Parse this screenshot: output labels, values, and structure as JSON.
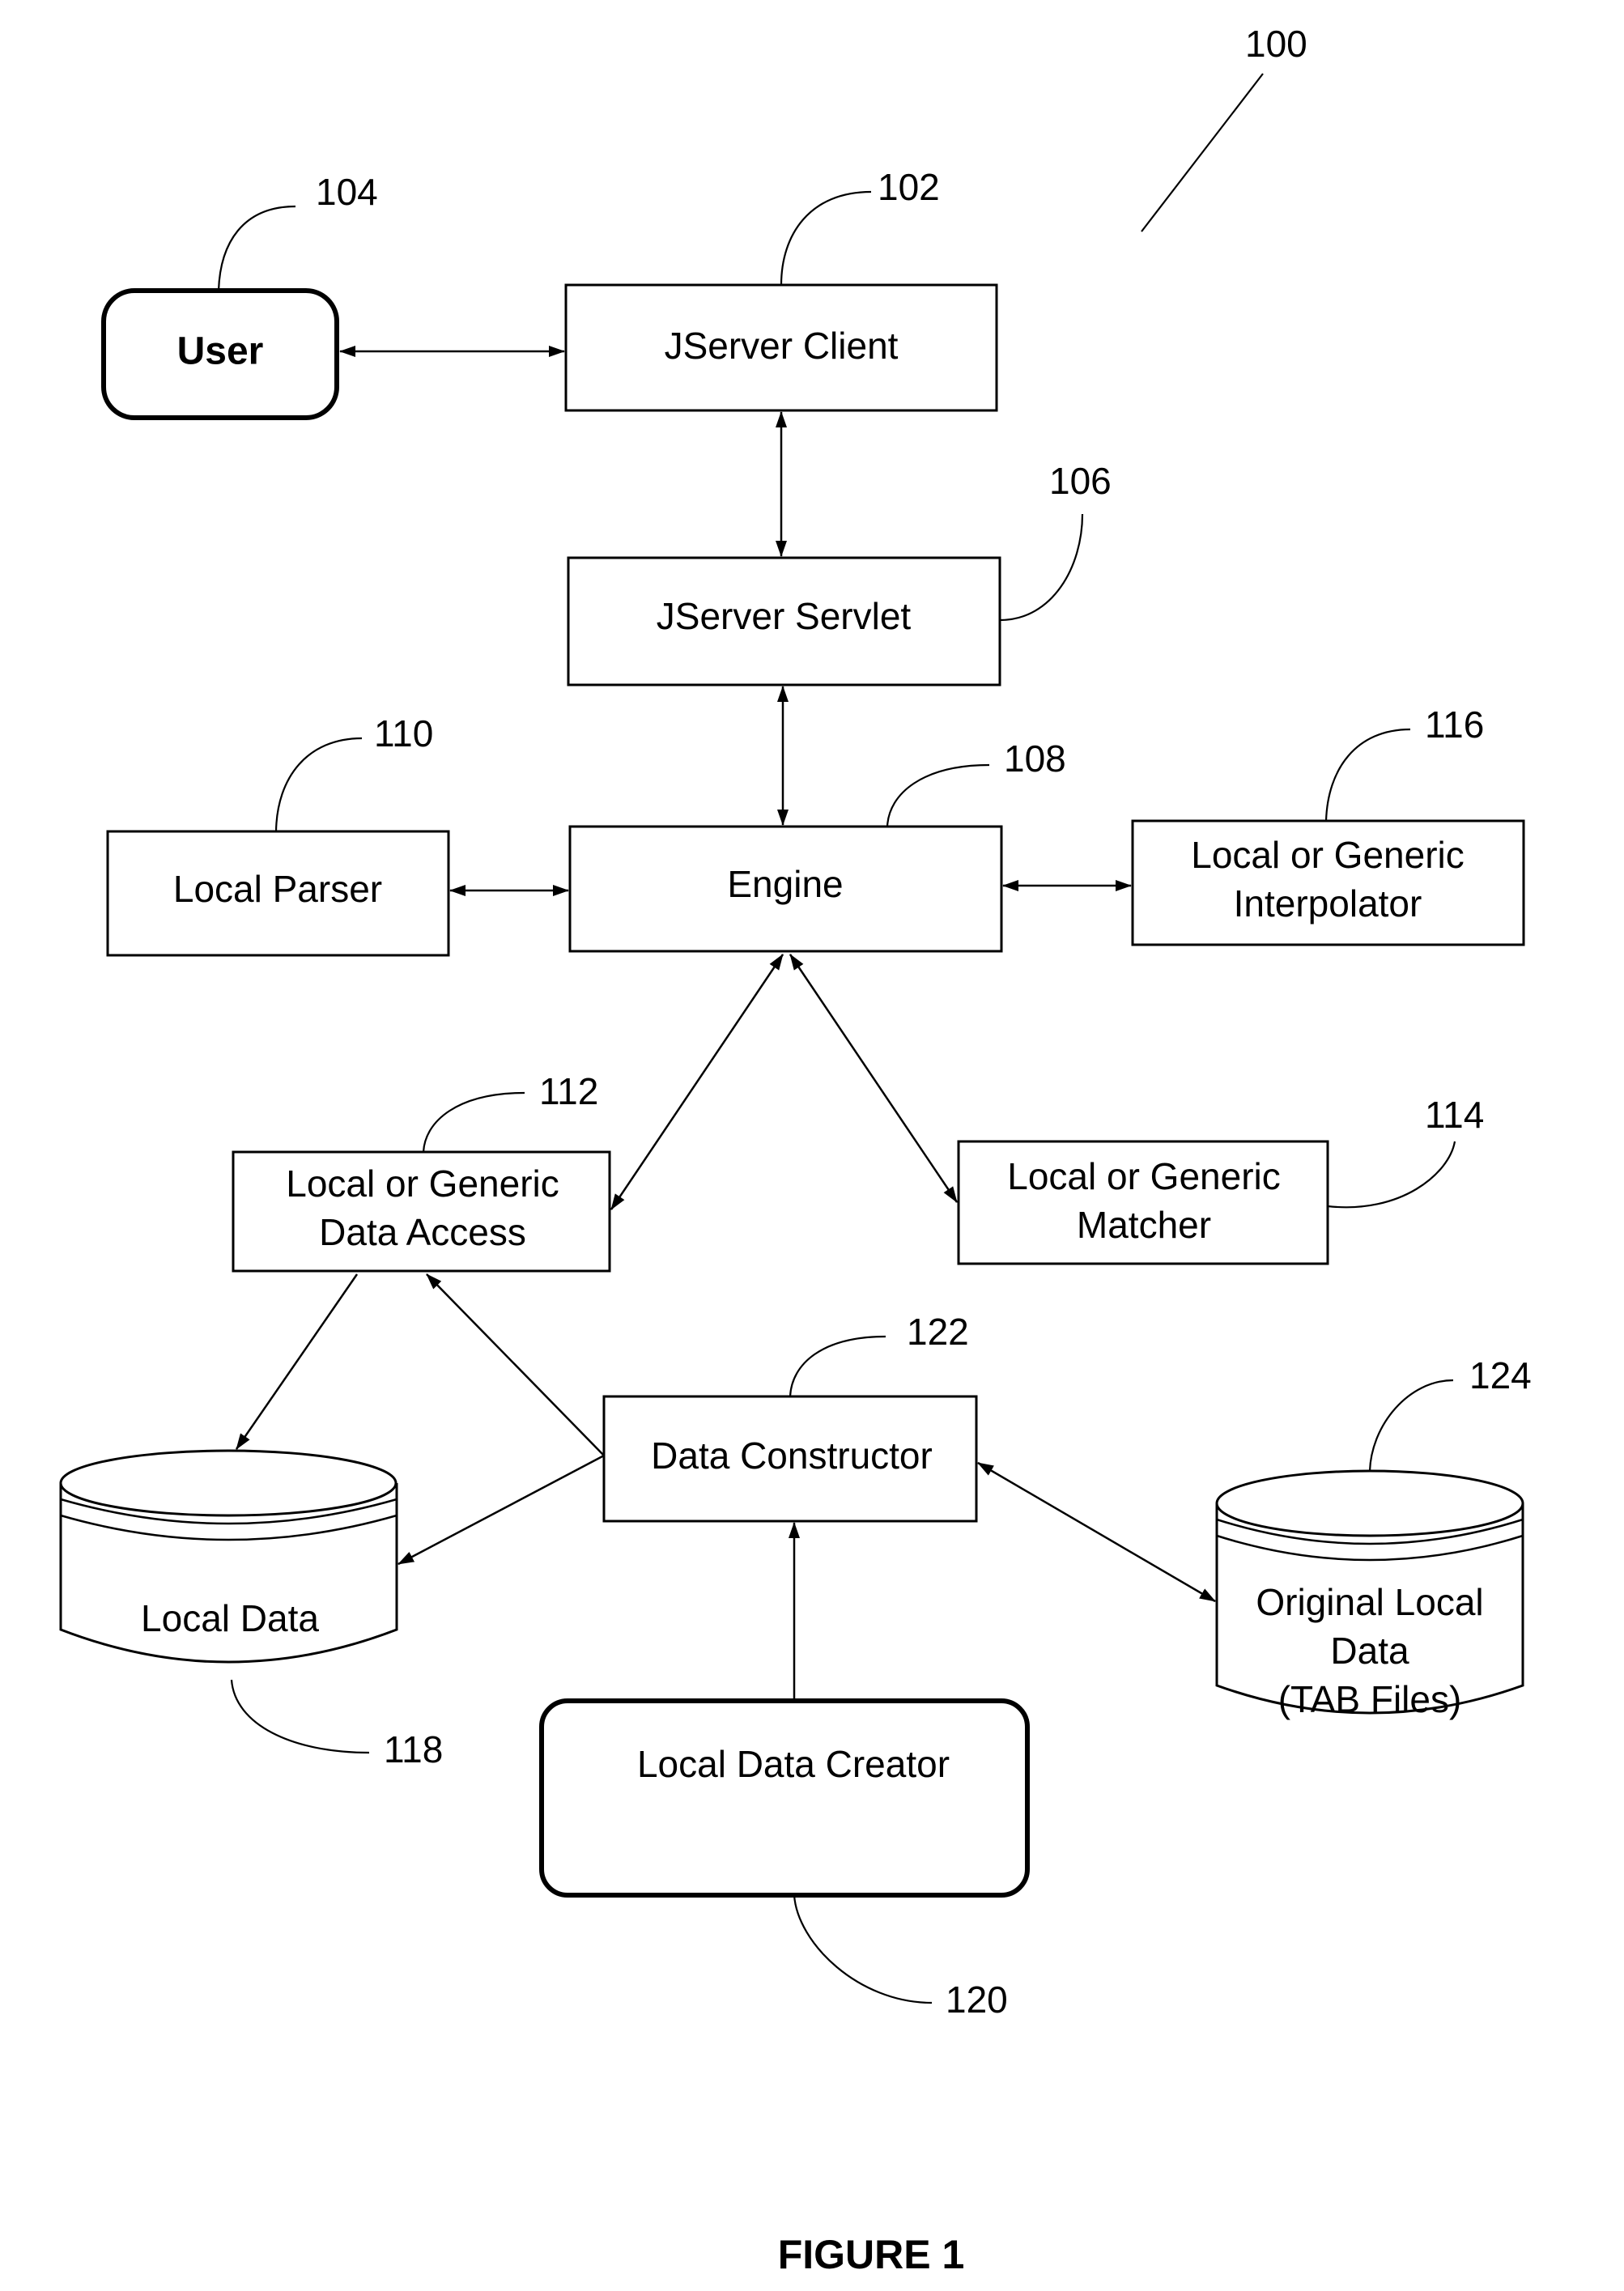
{
  "figure": {
    "caption": "FIGURE 1",
    "system_ref": "100"
  },
  "nodes": {
    "user": {
      "label": "User",
      "ref": "104"
    },
    "jserver_client": {
      "label": "JServer Client",
      "ref": "102"
    },
    "jserver_servlet": {
      "label": "JServer Servlet",
      "ref": "106"
    },
    "engine": {
      "label": "Engine",
      "ref": "108"
    },
    "local_parser": {
      "label": "Local Parser",
      "ref": "110"
    },
    "interpolator": {
      "label_lines": [
        "Local or Generic",
        "Interpolator"
      ],
      "ref": "116"
    },
    "data_access": {
      "label_lines": [
        "Local or Generic",
        "Data Access"
      ],
      "ref": "112"
    },
    "matcher": {
      "label_lines": [
        "Local or Generic",
        "Matcher"
      ],
      "ref": "114"
    },
    "data_constructor": {
      "label": "Data Constructor",
      "ref": "122"
    },
    "local_data": {
      "label": "Local Data",
      "ref": "118"
    },
    "original_local_data": {
      "label_lines": [
        "Original Local",
        "Data",
        "(TAB Files)"
      ],
      "ref": "124"
    },
    "local_data_creator": {
      "label": "Local Data Creator",
      "ref": "120"
    }
  },
  "edges": [
    {
      "from": "user",
      "to": "jserver_client",
      "direction": "both"
    },
    {
      "from": "jserver_client",
      "to": "jserver_servlet",
      "direction": "both"
    },
    {
      "from": "jserver_servlet",
      "to": "engine",
      "direction": "both"
    },
    {
      "from": "local_parser",
      "to": "engine",
      "direction": "both"
    },
    {
      "from": "engine",
      "to": "interpolator",
      "direction": "both"
    },
    {
      "from": "engine",
      "to": "data_access",
      "direction": "both"
    },
    {
      "from": "engine",
      "to": "matcher",
      "direction": "both"
    },
    {
      "from": "data_access",
      "to": "local_data",
      "direction": "forward"
    },
    {
      "from": "data_constructor",
      "to": "data_access",
      "direction": "forward"
    },
    {
      "from": "data_constructor",
      "to": "local_data",
      "direction": "forward"
    },
    {
      "from": "data_constructor",
      "to": "original_local_data",
      "direction": "both"
    },
    {
      "from": "local_data_creator",
      "to": "data_constructor",
      "direction": "forward"
    }
  ]
}
